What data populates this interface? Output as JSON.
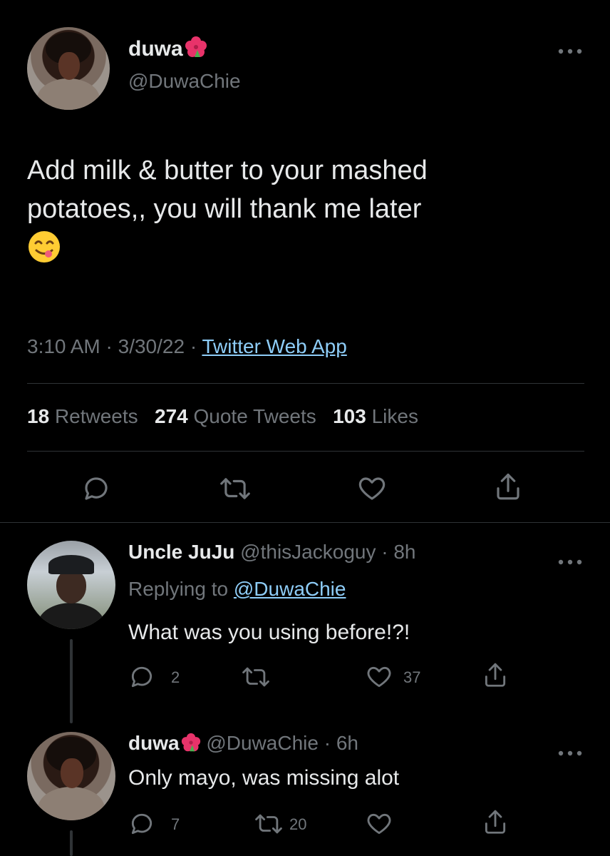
{
  "main_tweet": {
    "display_name": "duwa",
    "handle": "@DuwaChie",
    "text_line1": "Add milk & butter to your mashed",
    "text_line2": "potatoes,, you will thank me later",
    "emoji_name": "face-savoring-food-emoji",
    "time": "3:10 AM",
    "date": "3/30/22",
    "source": "Twitter Web App",
    "stats": {
      "retweets_count": "18",
      "retweets_label": "Retweets",
      "quotes_count": "274",
      "quotes_label": "Quote Tweets",
      "likes_count": "103",
      "likes_label": "Likes"
    }
  },
  "replies": [
    {
      "display_name": "Uncle JuJu",
      "handle": "@thisJackoguy",
      "age": "8h",
      "replying_label": "Replying to",
      "replying_to": "@DuwaChie",
      "text": "What was you using before!?!",
      "reply_count": "2",
      "retweet_count": "",
      "like_count": "37"
    },
    {
      "display_name": "duwa",
      "handle": "@DuwaChie",
      "age": "6h",
      "text": "Only mayo, was missing alot",
      "reply_count": "7",
      "retweet_count": "20",
      "like_count": ""
    }
  ],
  "icons": {
    "more": "more-horizontal-icon",
    "reply": "reply-bubble-icon",
    "retweet": "retweet-icon",
    "like": "heart-icon",
    "share": "share-icon",
    "flower": "hibiscus-emoji"
  },
  "colors": {
    "background": "#000000",
    "text": "#e7e9ea",
    "muted": "#71767b",
    "link": "#8ecdf8",
    "divider": "#2f3336"
  }
}
